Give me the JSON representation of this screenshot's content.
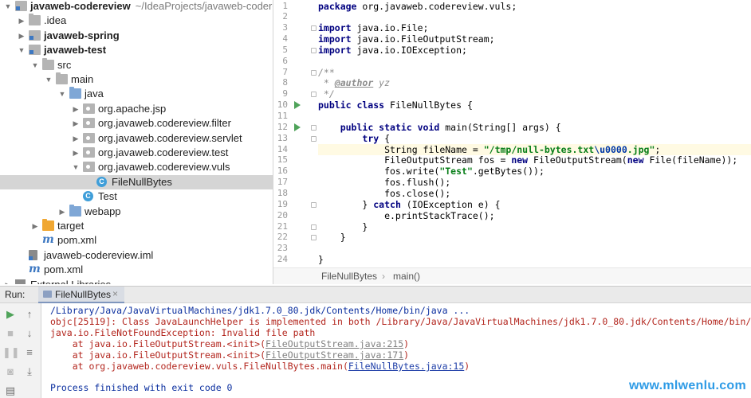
{
  "project_tree": {
    "items": [
      {
        "label": "javaweb-codereview",
        "path": "~/IdeaProjects/javaweb-codere",
        "bold": true,
        "arrow": "▼",
        "icon": "module-folder-icon",
        "depth": 0
      },
      {
        "label": ".idea",
        "arrow": "▶",
        "icon": "folder-icon",
        "depth": 1
      },
      {
        "label": "javaweb-spring",
        "bold": true,
        "arrow": "▶",
        "icon": "module-folder-icon",
        "depth": 1
      },
      {
        "label": "javaweb-test",
        "bold": true,
        "arrow": "▼",
        "icon": "module-folder-icon",
        "depth": 1
      },
      {
        "label": "src",
        "arrow": "▼",
        "icon": "folder-icon",
        "depth": 2
      },
      {
        "label": "main",
        "arrow": "▼",
        "icon": "folder-icon",
        "depth": 3
      },
      {
        "label": "java",
        "arrow": "▼",
        "icon": "source-folder-icon",
        "depth": 4
      },
      {
        "label": "org.apache.jsp",
        "arrow": "▶",
        "icon": "package-icon",
        "depth": 5
      },
      {
        "label": "org.javaweb.codereview.filter",
        "arrow": "▶",
        "icon": "package-icon",
        "depth": 5
      },
      {
        "label": "org.javaweb.codereview.servlet",
        "arrow": "▶",
        "icon": "package-icon",
        "depth": 5
      },
      {
        "label": "org.javaweb.codereview.test",
        "arrow": "▶",
        "icon": "package-icon",
        "depth": 5
      },
      {
        "label": "org.javaweb.codereview.vuls",
        "arrow": "▼",
        "icon": "package-icon",
        "depth": 5
      },
      {
        "label": "FileNullBytes",
        "arrow": "",
        "icon": "java-class-icon",
        "depth": 6,
        "selected": true
      },
      {
        "label": "Test",
        "arrow": "",
        "icon": "java-class-icon",
        "depth": 5
      },
      {
        "label": "webapp",
        "arrow": "▶",
        "icon": "web-folder-icon",
        "depth": 4
      },
      {
        "label": "target",
        "arrow": "▶",
        "icon": "excluded-folder-icon",
        "depth": 2
      },
      {
        "label": "pom.xml",
        "arrow": "",
        "icon": "maven-icon",
        "depth": 2
      },
      {
        "label": "javaweb-codereview.iml",
        "arrow": "",
        "icon": "iml-file-icon",
        "depth": 1
      },
      {
        "label": "pom.xml",
        "arrow": "",
        "icon": "maven-icon",
        "depth": 1
      },
      {
        "label": "External Libraries",
        "arrow": "▶",
        "icon": "external-libraries-icon",
        "depth": 0
      }
    ]
  },
  "editor": {
    "lines": [
      {
        "n": "1",
        "segs": [
          {
            "t": "package",
            "c": "kw"
          },
          {
            "t": " org.javaweb.codereview.vuls;"
          }
        ]
      },
      {
        "n": "2",
        "segs": []
      },
      {
        "n": "3",
        "segs": [
          {
            "t": "import",
            "c": "kw"
          },
          {
            "t": " java.io.File;"
          }
        ]
      },
      {
        "n": "4",
        "segs": [
          {
            "t": "import",
            "c": "kw"
          },
          {
            "t": " java.io.FileOutputStream;"
          }
        ]
      },
      {
        "n": "5",
        "segs": [
          {
            "t": "import",
            "c": "kw"
          },
          {
            "t": " java.io.IOException;"
          }
        ]
      },
      {
        "n": "6",
        "segs": []
      },
      {
        "n": "7",
        "segs": [
          {
            "t": "/**",
            "c": "cm"
          }
        ]
      },
      {
        "n": "8",
        "segs": [
          {
            "t": " * ",
            "c": "cm"
          },
          {
            "t": "@author",
            "c": "tag"
          },
          {
            "t": " yz",
            "c": "cm"
          }
        ]
      },
      {
        "n": "9",
        "segs": [
          {
            "t": " */",
            "c": "cm"
          }
        ]
      },
      {
        "n": "10",
        "segs": [
          {
            "t": "public class",
            "c": "kw"
          },
          {
            "t": " FileNullBytes {"
          }
        ]
      },
      {
        "n": "11",
        "segs": []
      },
      {
        "n": "12",
        "segs": [
          {
            "t": "    "
          },
          {
            "t": "public static void",
            "c": "kw"
          },
          {
            "t": " main(String[] args) {"
          }
        ]
      },
      {
        "n": "13",
        "segs": [
          {
            "t": "        "
          },
          {
            "t": "try",
            "c": "kw"
          },
          {
            "t": " {"
          }
        ]
      },
      {
        "n": "14",
        "hl": true,
        "segs": [
          {
            "t": "            String fileName = "
          },
          {
            "t": "\"/tmp/null-bytes.txt",
            "c": "str"
          },
          {
            "t": "\\u0000",
            "c": "esc"
          },
          {
            "t": ".jpg\"",
            "c": "str"
          },
          {
            "t": ";"
          }
        ]
      },
      {
        "n": "15",
        "segs": [
          {
            "t": "            FileOutputStream fos = "
          },
          {
            "t": "new",
            "c": "kw"
          },
          {
            "t": " FileOutputStream("
          },
          {
            "t": "new",
            "c": "kw"
          },
          {
            "t": " File(fileName));"
          }
        ]
      },
      {
        "n": "16",
        "segs": [
          {
            "t": "            fos.write("
          },
          {
            "t": "\"Test\"",
            "c": "str"
          },
          {
            "t": ".getBytes());"
          }
        ]
      },
      {
        "n": "17",
        "segs": [
          {
            "t": "            fos.flush();"
          }
        ]
      },
      {
        "n": "18",
        "segs": [
          {
            "t": "            fos.close();"
          }
        ]
      },
      {
        "n": "19",
        "segs": [
          {
            "t": "        } "
          },
          {
            "t": "catch",
            "c": "kw"
          },
          {
            "t": " (IOException e) {"
          }
        ]
      },
      {
        "n": "20",
        "segs": [
          {
            "t": "            e.printStackTrace();"
          }
        ]
      },
      {
        "n": "21",
        "segs": [
          {
            "t": "        }"
          }
        ]
      },
      {
        "n": "22",
        "segs": [
          {
            "t": "    }"
          }
        ]
      },
      {
        "n": "23",
        "segs": []
      },
      {
        "n": "24",
        "segs": [
          {
            "t": "}"
          }
        ]
      }
    ],
    "run_gutter_lines": [
      "10",
      "12"
    ],
    "fold_lines": [
      "3",
      "5",
      "7",
      "9",
      "12",
      "13",
      "19",
      "21",
      "22"
    ],
    "breadcrumb": {
      "class": "FileNullBytes",
      "separator": "›",
      "method": "main()"
    }
  },
  "run_panel": {
    "label": "Run:",
    "tab": {
      "label": "FileNullBytes",
      "close": "×"
    },
    "toolbar": [
      {
        "icon": "rerun-icon",
        "glyph": "▶"
      },
      {
        "icon": "scroll-up-icon",
        "glyph": "↑"
      },
      {
        "icon": "stop-icon",
        "glyph": "■"
      },
      {
        "icon": "scroll-down-icon",
        "glyph": "↓"
      },
      {
        "icon": "pause-icon",
        "glyph": "❚❚"
      },
      {
        "icon": "soft-wrap-icon",
        "glyph": "≡"
      },
      {
        "icon": "camera-icon",
        "glyph": "◙"
      },
      {
        "icon": "scroll-to-end-icon",
        "glyph": "⤓"
      },
      {
        "icon": "print-icon",
        "glyph": "▤"
      }
    ],
    "console": [
      {
        "segs": [
          {
            "t": "/Library/Java/JavaVirtualMachines/jdk1.7.0_80.jdk/Contents/Home/bin/java ...",
            "c": "c-path"
          }
        ]
      },
      {
        "segs": [
          {
            "t": "objc[25119]: Class JavaLaunchHelper is implemented in both /Library/Java/JavaVirtualMachines/jdk1.7.0_80.jdk/Contents/Home/bin/java (0x1",
            "c": "c-err"
          }
        ]
      },
      {
        "segs": [
          {
            "t": "java.io.FileNotFoundException: Invalid file path",
            "c": "c-err"
          }
        ]
      },
      {
        "segs": [
          {
            "t": "    at java.io.FileOutputStream.<init>(",
            "c": "c-err"
          },
          {
            "t": "FileOutputStream.java:215",
            "c": "c-link"
          },
          {
            "t": ")",
            "c": "c-err"
          }
        ]
      },
      {
        "segs": [
          {
            "t": "    at java.io.FileOutputStream.<init>(",
            "c": "c-err"
          },
          {
            "t": "FileOutputStream.java:171",
            "c": "c-link"
          },
          {
            "t": ")",
            "c": "c-err"
          }
        ]
      },
      {
        "segs": [
          {
            "t": "    at org.javaweb.codereview.vuls.FileNullBytes.main(",
            "c": "c-err"
          },
          {
            "t": "FileNullBytes.java:15",
            "c": "c-link blue"
          },
          {
            "t": ")",
            "c": "c-err"
          }
        ]
      },
      {
        "segs": []
      },
      {
        "segs": [
          {
            "t": "Process finished with exit code 0",
            "c": "c-ok"
          }
        ]
      }
    ]
  },
  "watermark": "www.mlwenlu.com",
  "colors": {
    "selection": "#d5d5d5",
    "keyword": "#000080",
    "string": "#067d17",
    "error": "#b3261e",
    "run_green": "#4fa35a",
    "watermark": "#2e9be6"
  }
}
